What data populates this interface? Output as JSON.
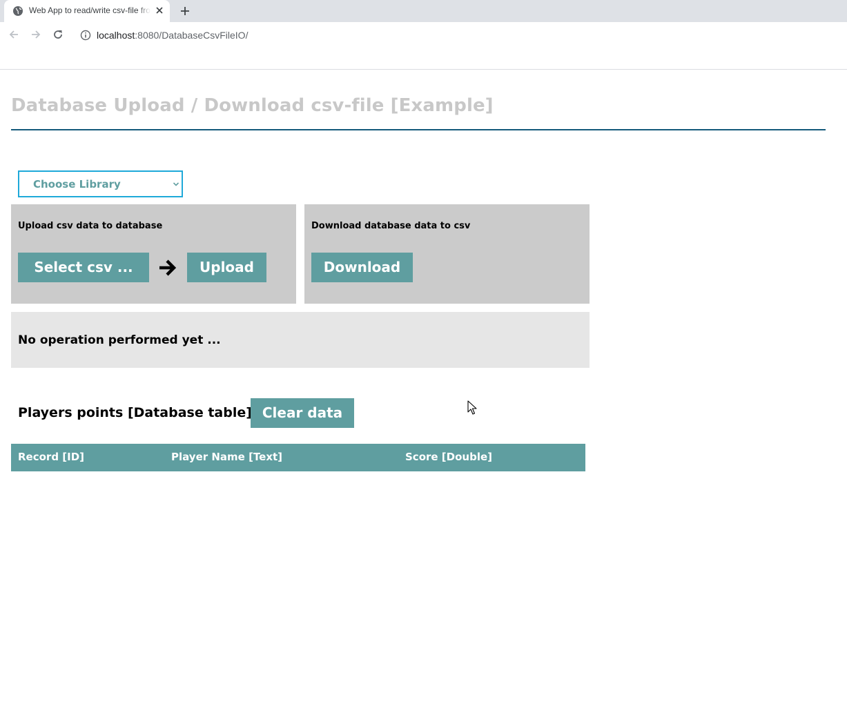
{
  "browser": {
    "tab_title": "Web App to read/write csv-file from database",
    "url_host": "localhost",
    "url_path": ":8080/DatabaseCsvFileIO/"
  },
  "page": {
    "title": "Database Upload / Download csv-file [Example]",
    "library_select": {
      "selected": "Choose Library"
    },
    "upload_panel": {
      "heading": "Upload csv data to database",
      "select_label": "Select csv ...",
      "upload_label": "Upload"
    },
    "download_panel": {
      "heading": "Download database data to csv",
      "download_label": "Download"
    },
    "status_message": "No operation performed yet ...",
    "table": {
      "title": "Players points [Database table]",
      "clear_label": "Clear data",
      "columns": [
        "Record [ID]",
        "Player Name [Text]",
        "Score [Double]"
      ]
    }
  },
  "colors": {
    "accent": "#5f9ea0",
    "title_rule": "#13597a",
    "select_border": "#1ea9d9",
    "panel_bg": "#cbcbcb",
    "status_bg": "#e6e6e6",
    "title_text": "#c8c8c8"
  },
  "icons": {
    "favicon": "globe-icon",
    "arrow": "arrow-right-icon",
    "cursor": "mouse-cursor-icon"
  }
}
